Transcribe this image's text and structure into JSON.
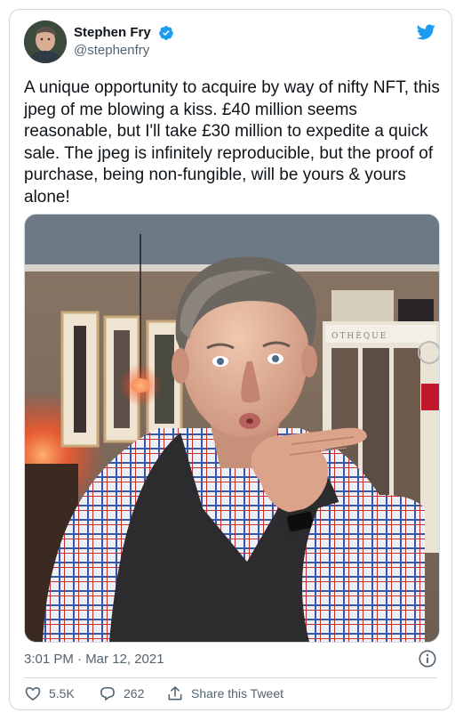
{
  "author": {
    "display_name": "Stephen Fry",
    "handle": "@stephenfry",
    "verified": true
  },
  "tweet": {
    "text": "A unique opportunity to acquire by way of nifty NFT, this jpeg of me blowing a kiss. £40 million seems reasonable, but I'll take £30 million to expedite a quick sale. The jpeg is infinitely reproducible, but the proof of purchase, being non-fungible, will be yours & yours alone!",
    "timestamp": "3:01 PM · Mar 12, 2021",
    "media_sign_text": "OTHÈQUE"
  },
  "actions": {
    "likes": "5.5K",
    "replies": "262",
    "share_label": "Share this Tweet"
  },
  "icons": {
    "brand": "twitter-bird-icon",
    "verified": "verified-badge-icon",
    "info": "info-icon",
    "like": "heart-icon",
    "reply": "reply-icon",
    "share": "share-icon"
  },
  "colors": {
    "twitter_blue": "#1d9bf0",
    "text_primary": "#0f1419",
    "text_secondary": "#536471",
    "border": "#cfd9de"
  }
}
